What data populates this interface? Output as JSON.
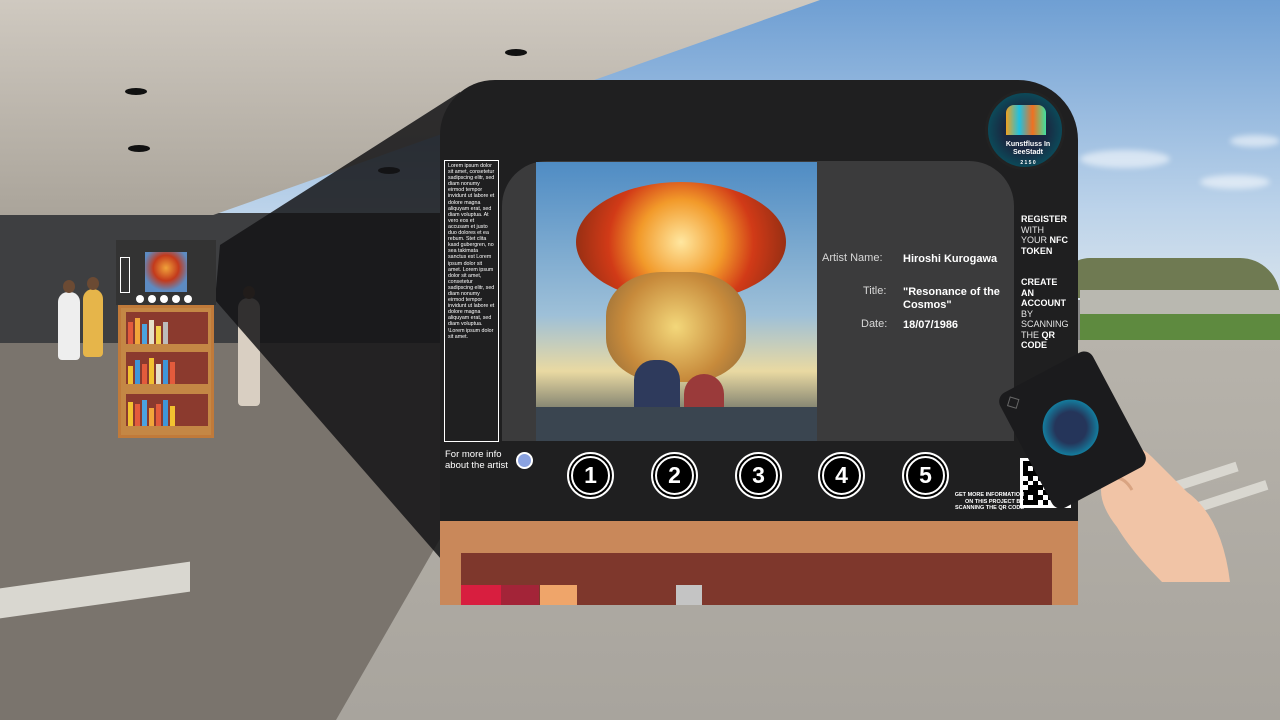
{
  "device": {
    "lorem_text": "Lorem ipsum dolor sit amet, consetetur sadipscing elitr, sed diam nonumy eirmod tempor invidunt ut labore et dolore magna aliquyam erat, sed diam voluptua. At vero eos et accusam et justo duo dolores et ea rebum. Stet clita kasd gubergren, no sea takimata sanctus est Lorem ipsum dolor sit amet. Lorem ipsum dolor sit amet, consetetur sadipscing elitr, sed diam nonumy eirmod tempor invidunt ut labore et dolore magna aliquyam erat, sed diam voluptua. \\Lorem ipsum dolor sit amet.",
    "artwork": {
      "artist_label": "Artist Name:",
      "artist_value": "Hiroshi Kurogawa",
      "title_label": "Title:",
      "title_value": "\"Resonance of the Cosmos\"",
      "date_label": "Date:",
      "date_value": "18/07/1986"
    },
    "logo_text": "Kunstfluss In SeeStadt",
    "logo_sub": "2 1 5 0",
    "register": {
      "line1": "REGISTER",
      "line2": "WITH",
      "line3_a": "YOUR ",
      "line3_b": "NFC",
      "line4": "TOKEN"
    },
    "account": {
      "line1": "CREATE",
      "line2": "AN",
      "line3": "ACCOUNT",
      "line4": "BY",
      "line5": "SCANNING",
      "line6_a": "THE ",
      "line6_b": "QR",
      "line7": "CODE"
    },
    "more_info": "For more info about the artist",
    "qr_note": "GET MORE INFORMATION ON THIS PROJECT BY SCANNING THE QR CODE",
    "buttons": [
      "1",
      "2",
      "3",
      "4",
      "5"
    ]
  },
  "colors": {
    "device_body": "#1f1f20",
    "screen": "#3b3b3c",
    "stand": "#c9885a",
    "stand_inner": "#7e372c",
    "accent_radio": "#8aa2e0"
  }
}
